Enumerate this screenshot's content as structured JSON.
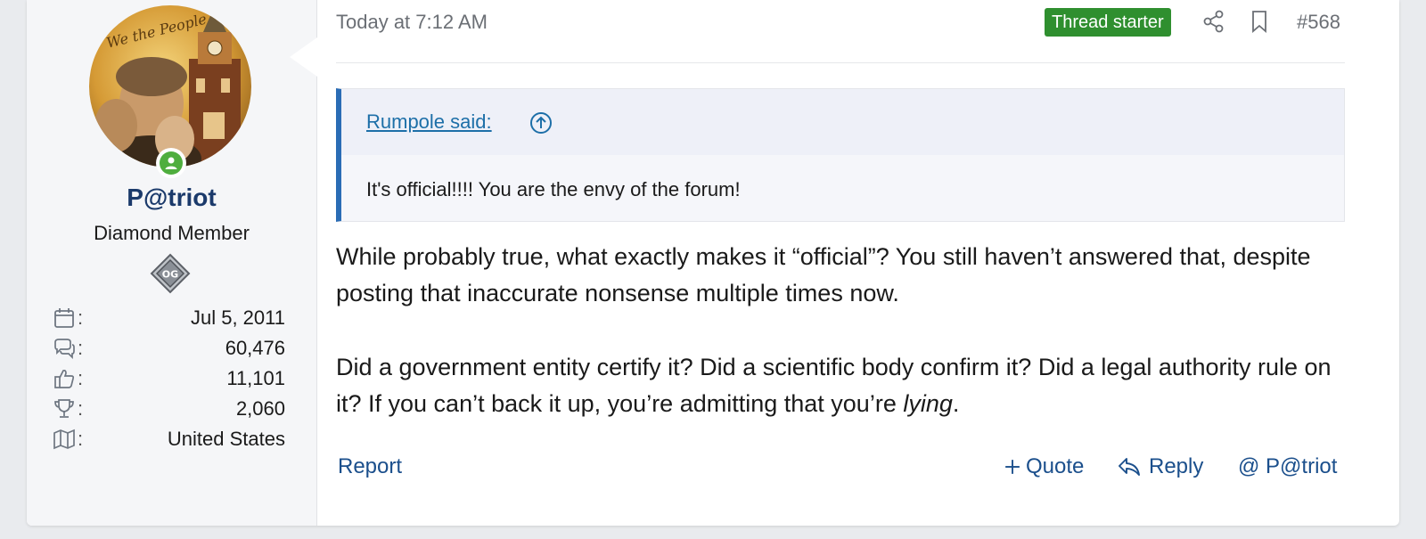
{
  "user": {
    "name": "P@triot",
    "title": "Diamond Member",
    "avatar_text": "We the People",
    "badge_text": "OG",
    "stats": [
      {
        "icon": "calendar-icon",
        "value": "Jul 5, 2011"
      },
      {
        "icon": "messages-icon",
        "value": "60,476"
      },
      {
        "icon": "thumbs-up-icon",
        "value": "11,101"
      },
      {
        "icon": "trophy-icon",
        "value": "2,060"
      },
      {
        "icon": "map-icon",
        "value": "United States"
      }
    ],
    "stat_colon": ":"
  },
  "post": {
    "timestamp": "Today at 7:12 AM",
    "thread_starter": "Thread starter",
    "number": "#568",
    "quote": {
      "author": "Rumpole said:",
      "text": "It's official!!!! You are the envy of the forum!"
    },
    "body": {
      "p1": "While probably true, what exactly makes it “official”? You still haven’t answered that, despite posting that inaccurate nonsense multiple times now.",
      "p2_main": "Did a government entity certify it? Did a scientific body confirm it? Did a legal authority rule on it? If you can’t back it up, you’re admitting that you’re ",
      "p2_em": "lying",
      "p2_end": "."
    },
    "actions": {
      "report": "Report",
      "quote": "Quote",
      "reply": "Reply",
      "mention": "@ P@triot"
    }
  },
  "colors": {
    "accent": "#1b4f8c",
    "username": "#1b3a6b",
    "thread_starter": "#2f8f2f",
    "quote_bar": "#2a6cb5",
    "online": "#4fae3e"
  }
}
